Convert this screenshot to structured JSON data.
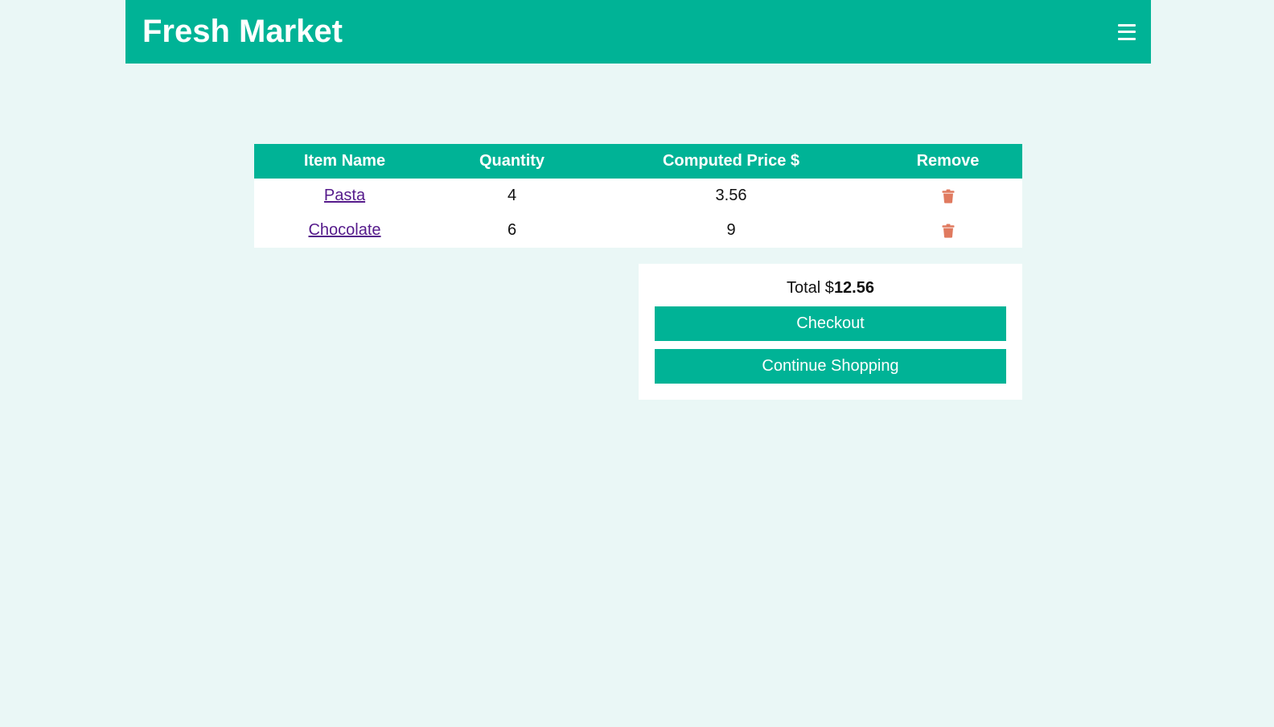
{
  "header": {
    "brand": "Fresh Market",
    "menu_icon": "hamburger-menu-icon"
  },
  "table": {
    "columns": [
      "Item Name",
      "Quantity",
      "Computed Price $",
      "Remove"
    ],
    "rows": [
      {
        "name": "Pasta",
        "quantity": "4",
        "price": "3.56",
        "remove_icon": "trash-icon"
      },
      {
        "name": "Chocolate",
        "quantity": "6",
        "price": "9",
        "remove_icon": "trash-icon"
      }
    ]
  },
  "summary": {
    "total_label": "Total $",
    "total_value": "12.56",
    "checkout_label": "Checkout",
    "continue_label": "Continue Shopping"
  },
  "colors": {
    "accent": "#00b396",
    "background": "#eaf7f6",
    "link": "#551a8b",
    "trash": "#e07a5f"
  }
}
